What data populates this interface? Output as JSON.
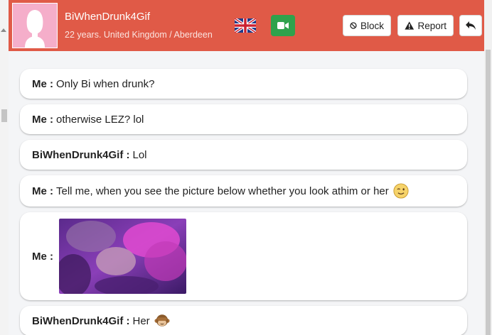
{
  "header": {
    "username": "BiWhenDrunk4Gif",
    "details": "22 years. United Kingdom / Aberdeen",
    "flag_icon": "uk-flag-icon",
    "video_icon": "video-camera-icon",
    "block_label": "Block",
    "report_label": "Report",
    "back_icon": "reply-arrow-icon",
    "accent": "#e05a47",
    "video_color": "#2fa24c"
  },
  "messages": [
    {
      "sender": "Me :",
      "text": "Only Bi when drunk?"
    },
    {
      "sender": "Me :",
      "text": "otherwise LEZ? lol"
    },
    {
      "sender": "BiWhenDrunk4Gif :",
      "text": "Lol"
    },
    {
      "sender": "Me :",
      "text": "Tell me, when you see the picture below whether you look athim or her",
      "emoji": "winking-face-icon"
    },
    {
      "sender": "Me :",
      "image": "photo-attachment"
    },
    {
      "sender": "BiWhenDrunk4Gif :",
      "text": "Her",
      "emoji": "see-no-evil-monkey-icon"
    }
  ]
}
